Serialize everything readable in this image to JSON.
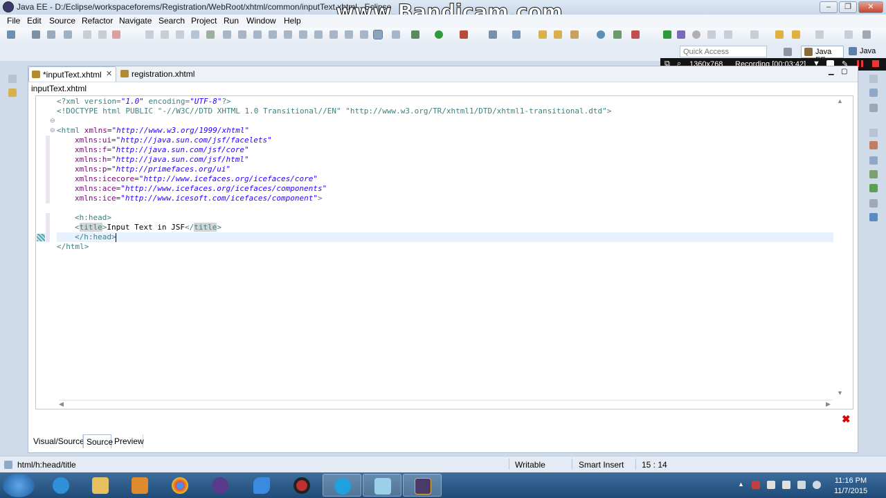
{
  "window": {
    "title": "Java EE - D:/Eclipse/workspaceforems/Registration/WebRoot/xhtml/common/inputText.xhtml - Eclipse",
    "watermark": "www.Bandicam.com",
    "controls": [
      "–",
      "❐",
      "✕"
    ]
  },
  "menu": [
    "File",
    "Edit",
    "Source",
    "Refactor",
    "Navigate",
    "Search",
    "Project",
    "Run",
    "Window",
    "Help"
  ],
  "quick_access": {
    "placeholder": "Quick Access"
  },
  "perspectives": {
    "java_ee": "Java EE",
    "java": "Java"
  },
  "recording": {
    "resolution": "1360x768",
    "status": "Recording [00:03:42]"
  },
  "editor": {
    "tabs": [
      {
        "label": "*inputText.xhtml"
      },
      {
        "label": "registration.xhtml"
      }
    ],
    "file_breadcrumb": "inputText.xhtml",
    "code": {
      "l1": {
        "a": "<?xml version=",
        "b": "\"1.0\"",
        "c": " encoding=",
        "d": "\"UTF-8\"",
        "e": "?>"
      },
      "l2": {
        "a": "<!DOCTYPE html PUBLIC ",
        "b": "\"-//W3C//DTD XHTML 1.0 Transitional//EN\"",
        "c": " ",
        "d": "\"http://www.w3.org/TR/xhtml1/DTD/xhtml1-transitional.dtd\"",
        "e": ">"
      },
      "l4": {
        "a": "<html ",
        "b": "xmlns=",
        "c": "\"http://www.w3.org/1999/xhtml\""
      },
      "l5": {
        "b": "xmlns:ui=",
        "c": "\"http://java.sun.com/jsf/facelets\""
      },
      "l6": {
        "b": "xmlns:f=",
        "c": "\"http://java.sun.com/jsf/core\""
      },
      "l7": {
        "b": "xmlns:h=",
        "c": "\"http://java.sun.com/jsf/html\""
      },
      "l8": {
        "b": "xmlns:p=",
        "c": "\"http://primefaces.org/ui\""
      },
      "l9": {
        "b": "xmlns:icecore=",
        "c": "\"http://www.icefaces.org/icefaces/core\""
      },
      "l10": {
        "b": "xmlns:ace=",
        "c": "\"http://www.icefaces.org/icefaces/components\""
      },
      "l11": {
        "b": "xmlns:ice=",
        "c": "\"http://www.icesoft.com/icefaces/component\"",
        "d": ">"
      },
      "l13": "<h:head>",
      "l14": {
        "a": "<",
        "b": "title",
        "c": ">",
        "d": "Input Text in JSF",
        "e": "</",
        "f": "title",
        "g": ">"
      },
      "l15": "</h:head>",
      "l16": "</html>"
    },
    "bottom_tabs": [
      "Visual/Source",
      "Source",
      "Preview"
    ]
  },
  "status": {
    "path": "html/h:head/title",
    "writable": "Writable",
    "insert_mode": "Smart Insert",
    "position": "15 : 14"
  },
  "clock": {
    "time": "11:16 PM",
    "date": "11/7/2015"
  },
  "colors": {
    "taskbar": "#1f4b78",
    "code_string": "#2a00ff",
    "code_tag": "#3f7f7f",
    "code_attr": "#7f007f"
  }
}
